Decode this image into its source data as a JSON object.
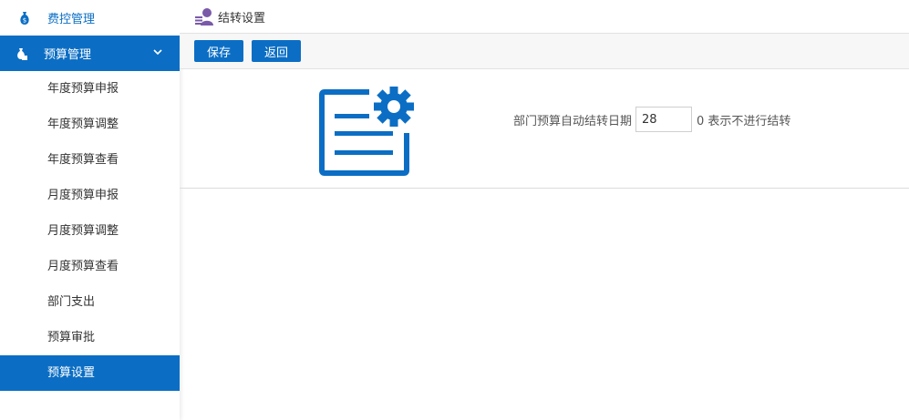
{
  "sidebar": {
    "top_item": {
      "label": "费控管理",
      "icon": "money-bag-icon"
    },
    "active_group": {
      "label": "预算管理",
      "icon": "money-bag-icon"
    },
    "sub_items": [
      {
        "label": "年度预算申报"
      },
      {
        "label": "年度预算调整"
      },
      {
        "label": "年度预算查看"
      },
      {
        "label": "月度预算申报"
      },
      {
        "label": "月度预算调整"
      },
      {
        "label": "月度预算查看"
      },
      {
        "label": "部门支出"
      },
      {
        "label": "预算审批"
      },
      {
        "label": "预算设置",
        "selected": true
      }
    ]
  },
  "header": {
    "title": "结转设置",
    "icon": "user-list-icon"
  },
  "toolbar": {
    "save_label": "保存",
    "back_label": "返回"
  },
  "form": {
    "label": "部门预算自动结转日期",
    "value": "28",
    "hint": "0 表示不进行结转",
    "icon": "document-settings-icon"
  },
  "colors": {
    "accent": "#0b6ec4"
  }
}
